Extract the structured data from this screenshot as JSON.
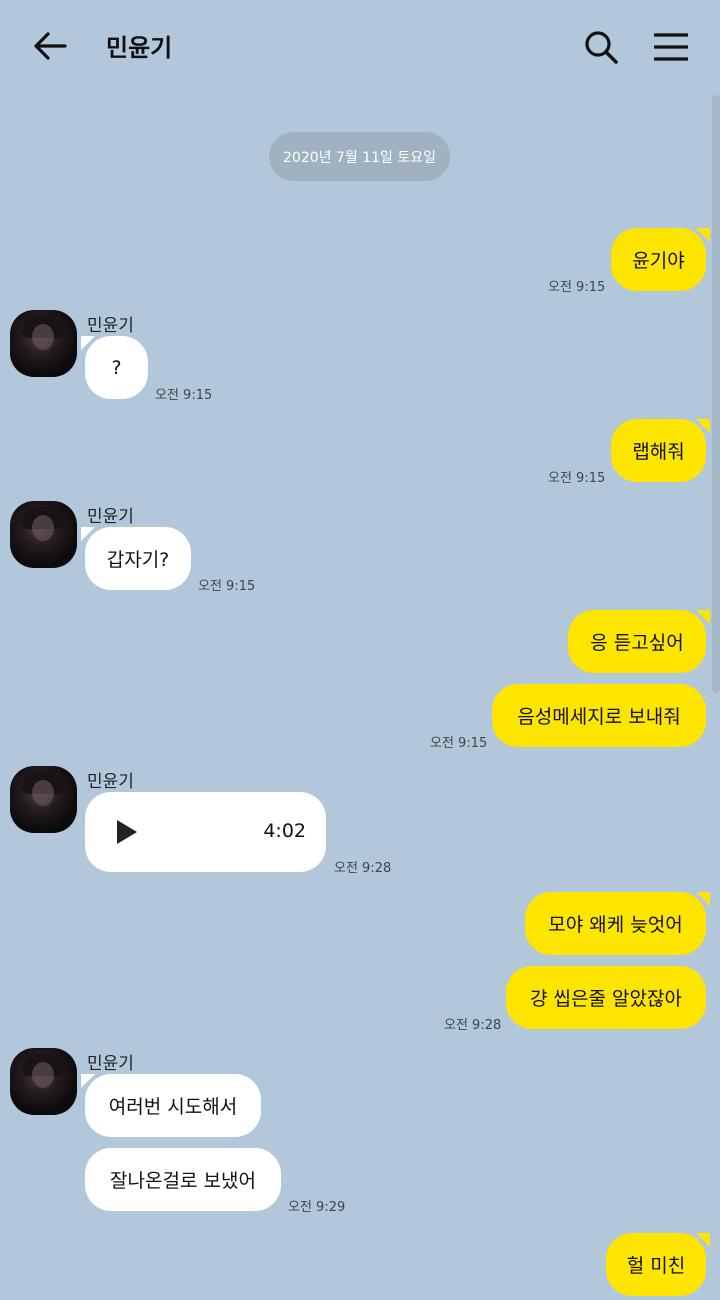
{
  "header": {
    "title": "민윤기"
  },
  "date_divider": "2020년 7월 11일 토요일",
  "contact": {
    "name": "민윤기"
  },
  "messages": {
    "m1": {
      "text": "윤기야",
      "time": "오전 9:15"
    },
    "m2": {
      "text": "?",
      "time": "오전 9:15"
    },
    "m3": {
      "text": "랩해줘",
      "time": "오전 9:15"
    },
    "m4": {
      "text": "갑자기?",
      "time": "오전 9:15"
    },
    "m5": {
      "text": "응 듣고싶어"
    },
    "m6": {
      "text": "음성메세지로 보내줘",
      "time": "오전 9:15"
    },
    "m7": {
      "duration": "4:02",
      "time": "오전 9:28"
    },
    "m8": {
      "text": "모야 왜케 늦엇어"
    },
    "m9": {
      "text": "걍 씹은줄 알았잖아",
      "time": "오전 9:28"
    },
    "m10": {
      "text": "여러번 시도해서"
    },
    "m11": {
      "text": "잘나온걸로 보냈어",
      "time": "오전 9:29"
    },
    "m12": {
      "text": "헐 미친"
    }
  },
  "colors": {
    "background": "#b2c7da",
    "my_bubble": "#fee500",
    "their_bubble": "#ffffff"
  },
  "icons": {
    "back": "arrow-left-icon",
    "search": "search-icon",
    "menu": "hamburger-menu-icon",
    "play": "play-icon"
  }
}
